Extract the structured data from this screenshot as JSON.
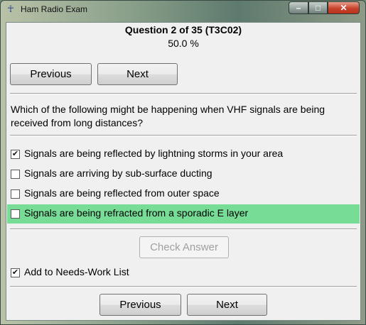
{
  "window": {
    "title": "Ham Radio Exam",
    "controls": {
      "minimize": "–",
      "maximize": "□",
      "close": "✕"
    }
  },
  "header": {
    "question_label": "Question 2 of 35 (T3C02)",
    "percent": "50.0 %"
  },
  "nav_top": {
    "previous": "Previous",
    "next": "Next"
  },
  "question": {
    "text": "Which of the following might be happening when VHF signals are being received from long distances?"
  },
  "options": [
    {
      "label": "Signals are being reflected by lightning storms in your area",
      "checked": true,
      "highlighted": false
    },
    {
      "label": "Signals are arriving by sub-surface ducting",
      "checked": false,
      "highlighted": false
    },
    {
      "label": "Signals are being reflected from outer space",
      "checked": false,
      "highlighted": false
    },
    {
      "label": "Signals are being refracted from a sporadic E layer",
      "checked": false,
      "highlighted": true
    }
  ],
  "check_answer": {
    "label": "Check Answer",
    "enabled": false
  },
  "needs_work": {
    "label": "Add to Needs-Work List",
    "checked": true
  },
  "nav_bottom": {
    "previous": "Previous",
    "next": "Next"
  },
  "colors": {
    "highlight": "#77dd96",
    "close_button": "#c8432c"
  }
}
